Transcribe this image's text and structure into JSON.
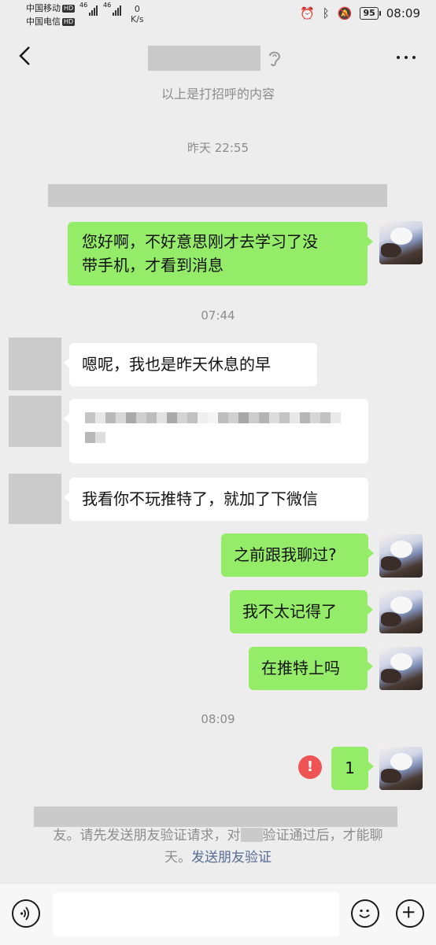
{
  "status_bar": {
    "carrier1": "中国移动",
    "carrier2": "中国电信",
    "badge": "HD",
    "net1": "46",
    "net2": "46",
    "speed_value": "0",
    "speed_unit": "K/s",
    "battery": "95",
    "time": "08:09"
  },
  "header": {
    "back_icon": "chevron-left-icon",
    "ear_icon": "ear-icon",
    "more_icon": "more-dots-icon"
  },
  "greeting_note": "以上是打招呼的内容",
  "timestamps": [
    "昨天 22:55",
    "07:44",
    "08:09"
  ],
  "messages": [
    {
      "side": "right",
      "text_line1": "您好啊，不好意思刚才去学习了没",
      "text_line2": "带手机，才看到消息"
    },
    {
      "side": "left",
      "text": "嗯呢，我也是昨天休息的早"
    },
    {
      "side": "left",
      "text": ""
    },
    {
      "side": "left",
      "text": "我看你不玩推特了，就加了下微信"
    },
    {
      "side": "right",
      "text": "之前跟我聊过?"
    },
    {
      "side": "right",
      "text": "我不太记得了"
    },
    {
      "side": "right",
      "text": "在推特上吗"
    },
    {
      "side": "right",
      "text": "1",
      "status": "failed"
    }
  ],
  "error_badge": "!",
  "notice": {
    "part1": "友。请先发送朋友验证请求，对",
    "part2": "验证通过后，才能聊",
    "part3": "天。",
    "link": "发送朋友验证"
  },
  "input_bar": {
    "voice_icon": "voice-icon",
    "emoji_icon": "emoji-icon",
    "plus_icon": "plus-icon",
    "placeholder": ""
  },
  "colors": {
    "background": "#ededed",
    "bubble_self": "#95ec69",
    "bubble_other": "#ffffff",
    "link": "#576b95",
    "error": "#ee5454"
  }
}
